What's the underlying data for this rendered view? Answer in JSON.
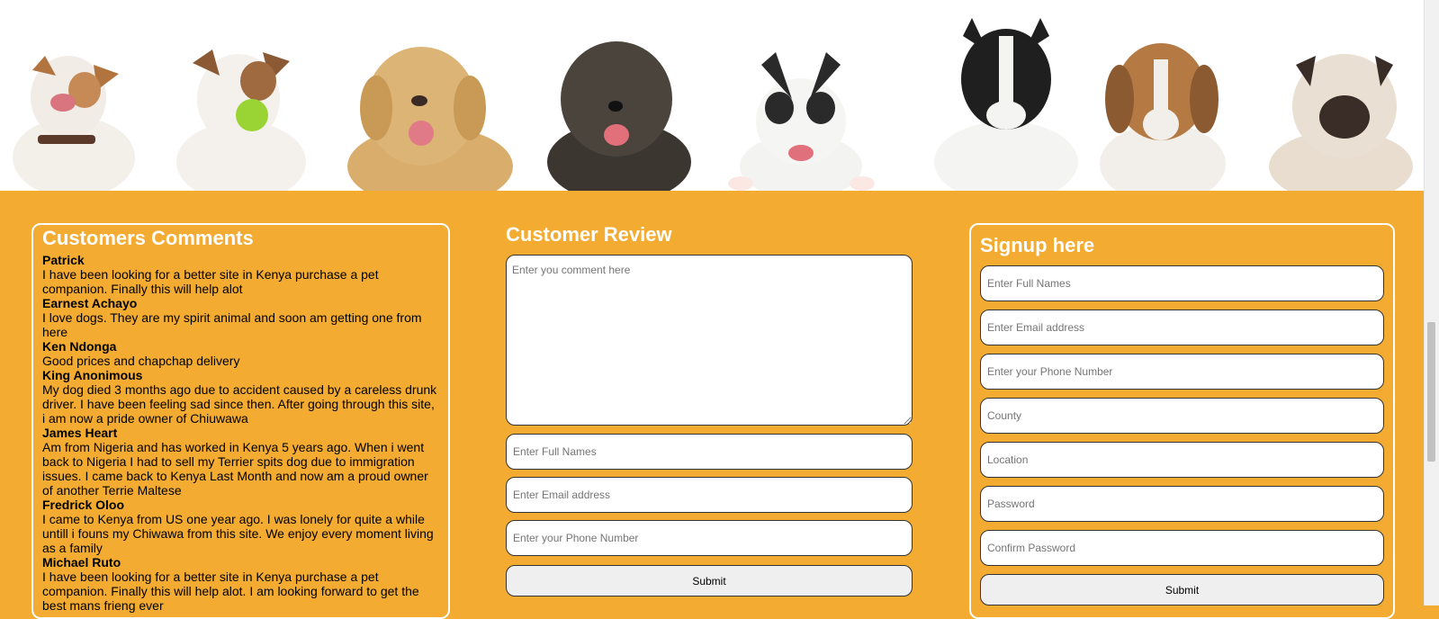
{
  "banner": {
    "alt": "dogs-banner"
  },
  "comments": {
    "title": "Customers Comments",
    "items": [
      {
        "name": "Patrick",
        "text": "I have been looking for a better site in Kenya purchase a pet companion. Finally this will help alot"
      },
      {
        "name": "Earnest Achayo",
        "text": "I love dogs. They are my spirit animal and soon am getting one from here"
      },
      {
        "name": "Ken Ndonga",
        "text": "Good prices and chapchap delivery"
      },
      {
        "name": "King Anonimous",
        "text": "My dog died 3 months ago due to accident caused by a careless drunk driver. I have been feeling sad since then. After going through this site, i am now a pride owner of Chiuwawa"
      },
      {
        "name": "James Heart",
        "text": "Am from Nigeria and has worked in Kenya 5 years ago. When i went back to Nigeria I had to sell my Terrier spits dog due to immigration issues. I came back to Kenya Last Month and now am a proud owner of another Terrie Maltese"
      },
      {
        "name": "Fredrick Oloo",
        "text": "I came to Kenya from US one year ago. I was lonely for quite a while untill i founs my Chiwawa from this site. We enjoy every moment living as a family"
      },
      {
        "name": "Michael Ruto",
        "text": "I have been looking for a better site in Kenya purchase a pet companion. Finally this will help alot. I am looking forward to get the best mans frieng ever"
      }
    ]
  },
  "review": {
    "title": "Customer Review",
    "comment_placeholder": "Enter you comment here",
    "name_placeholder": "Enter Full Names",
    "email_placeholder": "Enter Email address",
    "phone_placeholder": "Enter your Phone Number",
    "submit_label": "Submit"
  },
  "signup": {
    "title": "Signup here",
    "name_placeholder": "Enter Full Names",
    "email_placeholder": "Enter Email address",
    "phone_placeholder": "Enter your Phone Number",
    "county_placeholder": "County",
    "location_placeholder": "Location",
    "password_placeholder": "Password",
    "confirm_placeholder": "Confirm Password",
    "submit_label": "Submit"
  },
  "colors": {
    "page_bg": "#f3ab31",
    "panel_border": "#ffffff"
  }
}
